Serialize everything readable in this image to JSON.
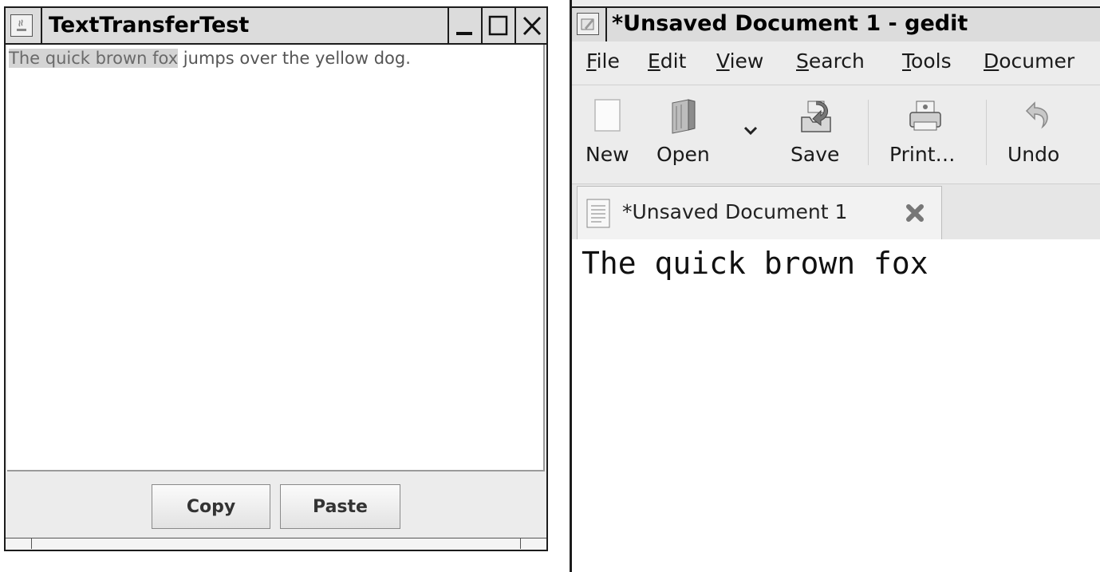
{
  "left_window": {
    "title": "TextTransferTest",
    "window_buttons": [
      "minimize",
      "maximize",
      "close"
    ],
    "text_selected": "The quick brown fox",
    "text_rest": " jumps over the yellow dog.",
    "buttons": {
      "copy": "Copy",
      "paste": "Paste"
    }
  },
  "right_window": {
    "title": "*Unsaved Document 1 - gedit",
    "menu": [
      {
        "mnemonic": "F",
        "rest": "ile"
      },
      {
        "mnemonic": "E",
        "rest": "dit"
      },
      {
        "mnemonic": "V",
        "rest": "iew"
      },
      {
        "mnemonic": "S",
        "rest": "earch"
      },
      {
        "mnemonic": "T",
        "rest": "ools"
      },
      {
        "mnemonic": "D",
        "rest": "ocumer"
      }
    ],
    "toolbar": {
      "new": "New",
      "open": "Open",
      "save": "Save",
      "print": "Print…",
      "undo": "Undo"
    },
    "tab": {
      "label": "*Unsaved Document 1"
    },
    "editor_text": "The quick brown fox"
  }
}
